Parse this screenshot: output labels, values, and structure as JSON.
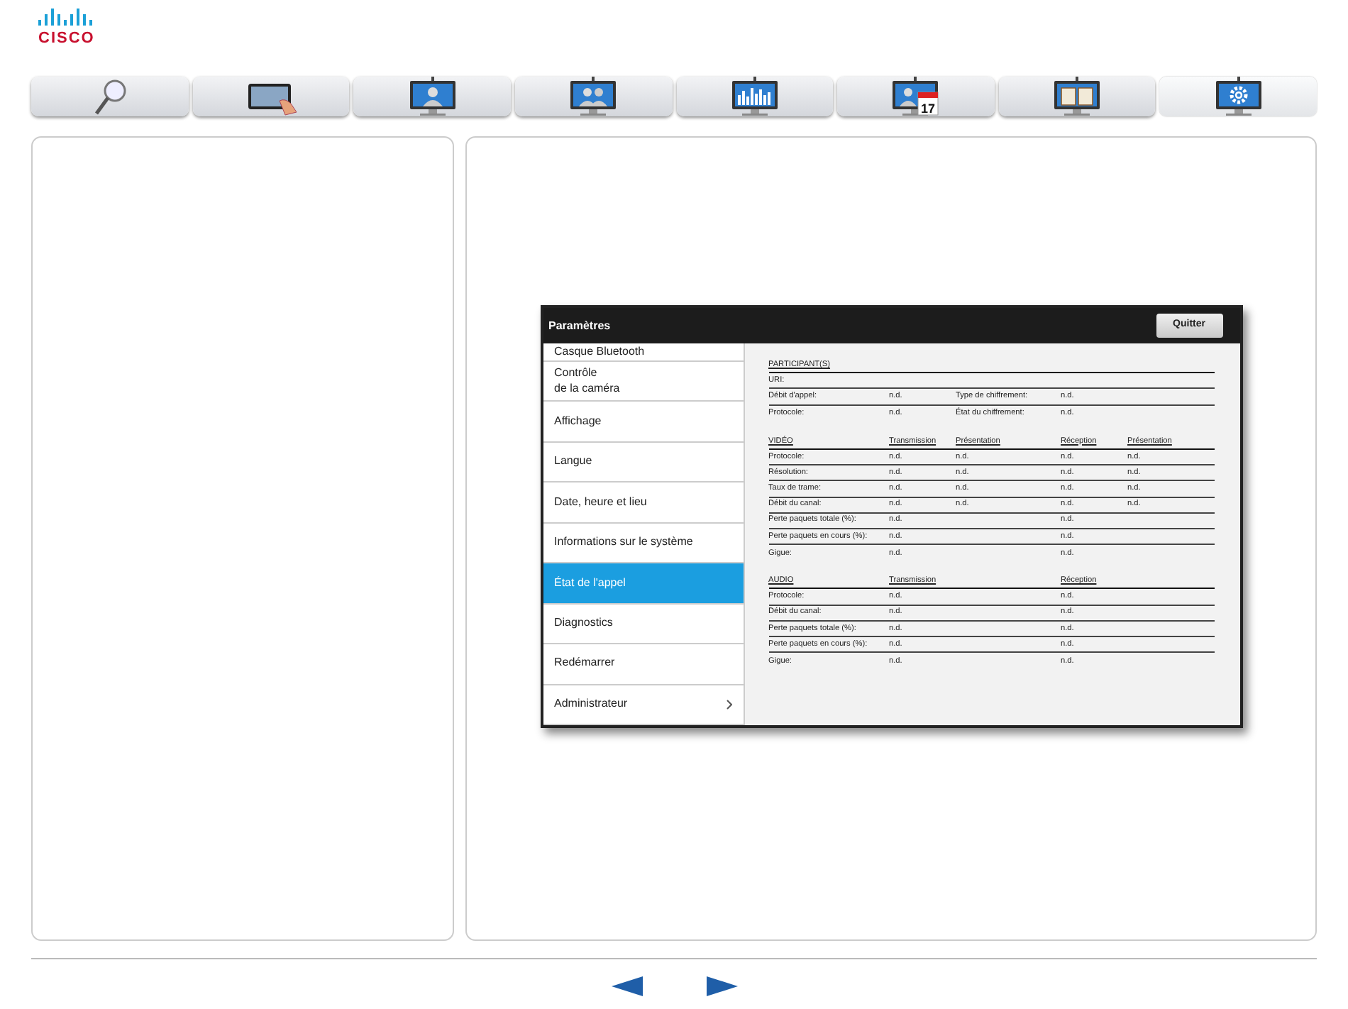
{
  "logo": {
    "text": "CISCO"
  },
  "tabs": [
    {
      "kind": "search",
      "selected": false
    },
    {
      "kind": "touch",
      "selected": false
    },
    {
      "kind": "person",
      "selected": false
    },
    {
      "kind": "people",
      "selected": false
    },
    {
      "kind": "chart",
      "selected": false
    },
    {
      "kind": "calendar",
      "selected": false,
      "day": "17"
    },
    {
      "kind": "book",
      "selected": false
    },
    {
      "kind": "gear",
      "selected": true
    }
  ],
  "device_window": {
    "title": "Paramètres",
    "quit_button": "Quitter",
    "menu": [
      {
        "label": "Casque Bluetooth",
        "selected": false,
        "has_submenu": false
      },
      {
        "label": "Contrôle\nde la caméra",
        "selected": false,
        "has_submenu": false
      },
      {
        "label": "Affichage",
        "selected": false,
        "has_submenu": false
      },
      {
        "label": "Langue",
        "selected": false,
        "has_submenu": false
      },
      {
        "label": "Date, heure et lieu",
        "selected": false,
        "has_submenu": false
      },
      {
        "label": "Informations sur le système",
        "selected": false,
        "has_submenu": false
      },
      {
        "label": "État de l'appel",
        "selected": true,
        "has_submenu": false
      },
      {
        "label": "Diagnostics",
        "selected": false,
        "has_submenu": false
      },
      {
        "label": "Redémarrer",
        "selected": false,
        "has_submenu": false
      },
      {
        "label": "Administrateur",
        "selected": false,
        "has_submenu": true
      }
    ],
    "sections": [
      {
        "header": {
          "column_1": "PARTICIPANT(S)"
        },
        "rows": [
          {
            "column_1": "URI:"
          },
          {
            "column_1": "Débit d'appel:",
            "column_2": "n.d.",
            "column_3": "Type de chiffrement:",
            "column_4": "n.d."
          },
          {
            "column_1": "Protocole:",
            "column_2": "n.d.",
            "column_3": "État du chiffrement:",
            "column_4": "n.d."
          }
        ]
      },
      {
        "header": {
          "column_1": "VIDÉO",
          "column_2": "Transmission",
          "column_3": "Présentation",
          "column_4": "Réception",
          "column_5": "Présentation"
        },
        "rows": [
          {
            "column_1": "Protocole:",
            "column_2": "n.d.",
            "column_3": "n.d.",
            "column_4": "n.d.",
            "column_5": "n.d."
          },
          {
            "column_1": "Résolution:",
            "column_2": "n.d.",
            "column_3": "n.d.",
            "column_4": "n.d.",
            "column_5": "n.d."
          },
          {
            "column_1": "Taux de trame:",
            "column_2": "n.d.",
            "column_3": "n.d.",
            "column_4": "n.d.",
            "column_5": "n.d."
          },
          {
            "column_1": "Débit du canal:",
            "column_2": "n.d.",
            "column_3": "n.d.",
            "column_4": "n.d.",
            "column_5": "n.d."
          },
          {
            "column_1": "Perte paquets totale (%):",
            "column_2": "n.d.",
            "column_4": "n.d."
          },
          {
            "column_1": "Perte paquets en cours (%):",
            "column_2": "n.d.",
            "column_4": "n.d."
          },
          {
            "column_1": "Gigue:",
            "column_2": "n.d.",
            "column_4": "n.d."
          }
        ]
      },
      {
        "header": {
          "column_1": "AUDIO",
          "column_2": "Transmission",
          "column_4": "Réception"
        },
        "rows": [
          {
            "column_1": "Protocole:",
            "column_2": "n.d.",
            "column_4": "n.d."
          },
          {
            "column_1": "Débit du canal:",
            "column_2": "n.d.",
            "column_4": "n.d."
          },
          {
            "column_1": "Perte paquets totale (%):",
            "column_2": "n.d.",
            "column_4": "n.d."
          },
          {
            "column_1": "Perte paquets en cours (%):",
            "column_2": "n.d.",
            "column_4": "n.d."
          },
          {
            "column_1": "Gigue:",
            "column_2": "n.d.",
            "column_4": "n.d."
          }
        ]
      }
    ]
  }
}
